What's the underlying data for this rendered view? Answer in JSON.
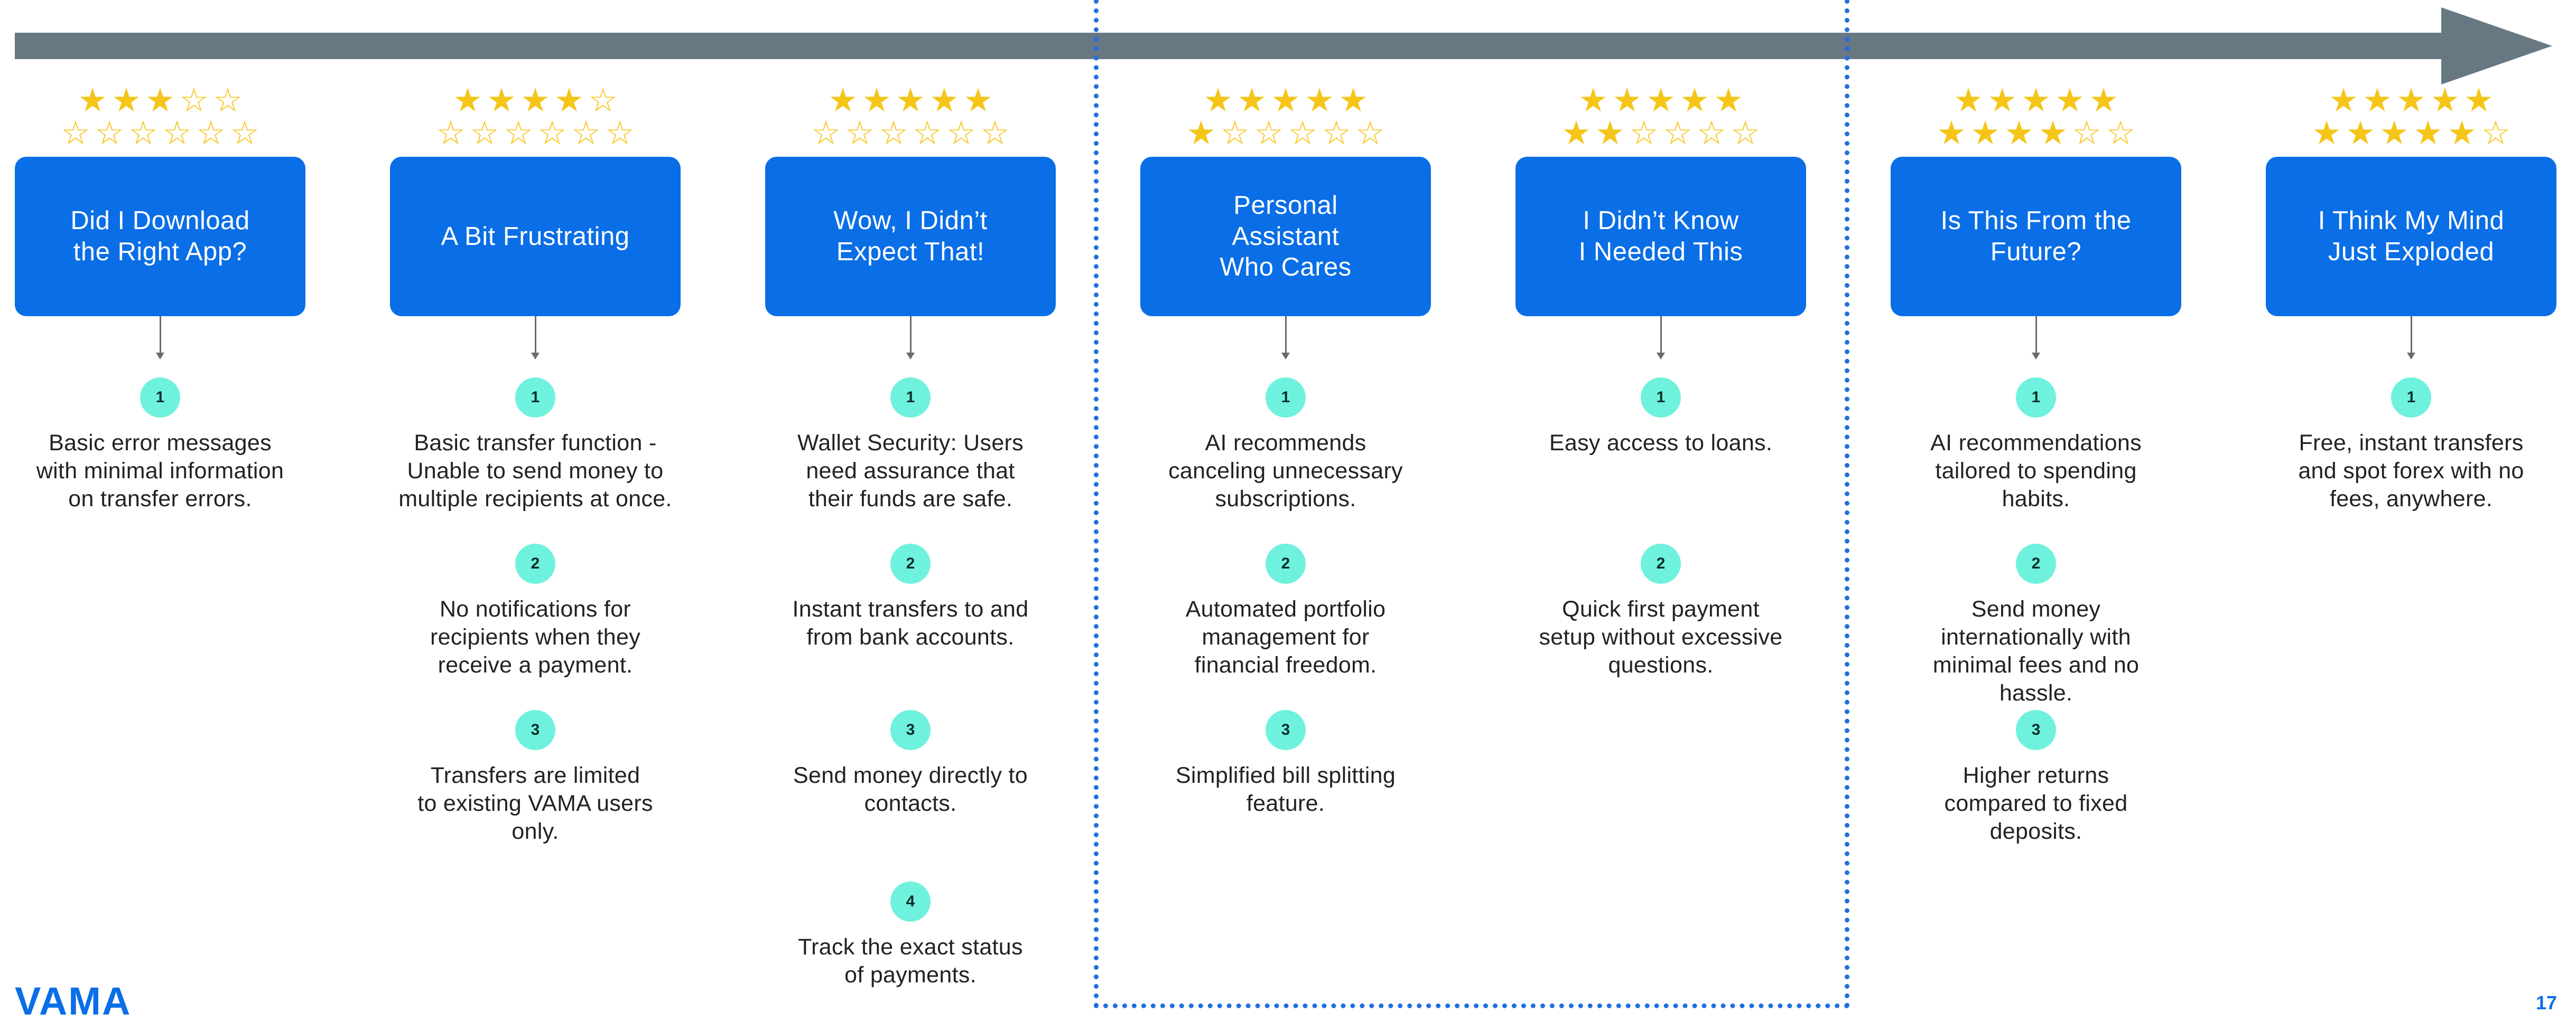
{
  "colors": {
    "accent": "#0a6ee6",
    "badge": "#6ff2dd",
    "star": "#f5c518",
    "arrow": "#677883",
    "highlight": "#1f6fde"
  },
  "stages": [
    {
      "title": "Did I Download\nthe Right App?",
      "rating": 1.5,
      "items": [
        {
          "num": "1",
          "text": "Basic error messages\nwith minimal information\non transfer errors."
        }
      ]
    },
    {
      "title": "A Bit Frustrating",
      "rating": 2,
      "items": [
        {
          "num": "1",
          "text": "Basic transfer function -\nUnable to send money to\nmultiple recipients at once."
        },
        {
          "num": "2",
          "text": "No notifications for\nrecipients when they\nreceive a payment."
        },
        {
          "num": "3",
          "text": "Transfers are limited\nto existing VAMA users\nonly."
        }
      ]
    },
    {
      "title": "Wow, I Didn’t\nExpect That!",
      "rating": 2.5,
      "items": [
        {
          "num": "1",
          "text": "Wallet Security: Users\nneed assurance that\ntheir funds are safe."
        },
        {
          "num": "2",
          "text": "Instant transfers to and\nfrom bank accounts."
        },
        {
          "num": "3",
          "text": "Send money directly to\ncontacts."
        },
        {
          "num": "4",
          "text": "Track the exact status\nof payments."
        }
      ]
    },
    {
      "title": "Personal\nAssistant\nWho Cares",
      "rating": 3,
      "items": [
        {
          "num": "1",
          "text": "AI recommends\ncanceling unnecessary\nsubscriptions."
        },
        {
          "num": "2",
          "text": "Automated portfolio\nmanagement for\nfinancial freedom."
        },
        {
          "num": "3",
          "text": "Simplified bill splitting\nfeature."
        }
      ]
    },
    {
      "title": "I Didn’t Know\nI Needed This",
      "rating": 3.5,
      "items": [
        {
          "num": "1",
          "text": "Easy access to loans."
        },
        {
          "num": "2",
          "text": "Quick first payment\nsetup without excessive\nquestions."
        }
      ]
    },
    {
      "title": "Is This From the\nFuture?",
      "rating": 4.5,
      "items": [
        {
          "num": "1",
          "text": "AI recommendations\ntailored to spending\nhabits."
        },
        {
          "num": "2",
          "text": "Send money\ninternationally with\nminimal fees and no\nhassle."
        },
        {
          "num": "3",
          "text": "Higher returns\ncompared to fixed\ndeposits."
        }
      ]
    },
    {
      "title": "I Think My Mind\nJust Exploded",
      "rating": 5,
      "items": [
        {
          "num": "1",
          "text": "Free, instant transfers\nand spot forex with no\nfees, anywhere."
        }
      ]
    }
  ],
  "footer": {
    "logo": "VAMA",
    "page": "17"
  }
}
